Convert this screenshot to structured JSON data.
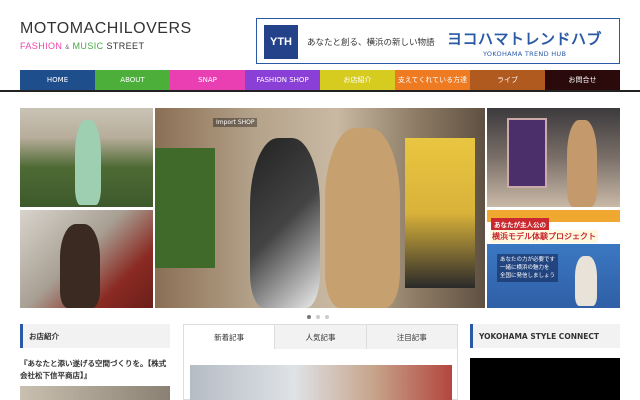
{
  "header": {
    "site_title": "MOTOMACHILOVERS",
    "sub_fashion": "FASHION",
    "sub_amp": "&",
    "sub_music": "MUSIC",
    "sub_street": "STREET"
  },
  "banner": {
    "logo_text": "YTH",
    "tagline": "あなたと創る、横浜の新しい物語",
    "brand": "ヨコハマトレンドハブ",
    "brand_en": "YOKOHAMA TREND HUB"
  },
  "nav": {
    "items": [
      {
        "label": "HOME",
        "color": "#1f4e8c"
      },
      {
        "label": "ABOUT",
        "color": "#4caf3a"
      },
      {
        "label": "SNAP",
        "color": "#e93fb2"
      },
      {
        "label": "FASHION SHOP",
        "color": "#8a3fd6"
      },
      {
        "label": "お店紹介",
        "color": "#d6cc1f"
      },
      {
        "label": "支えてくれている方達",
        "color": "#ee7a22"
      },
      {
        "label": "ライブ",
        "color": "#b05a1f"
      },
      {
        "label": "お問合せ",
        "color": "#2a0a0a"
      }
    ]
  },
  "slider": {
    "shop_sign": "Import   SHOP",
    "project_head": "あなたが主人公の",
    "project_title": "横浜モデル体験プロジェクト",
    "project_note_1": "あなたの力が必要です",
    "project_note_2": "一緒に横浜の魅力を",
    "project_note_3": "全国に発信しましょう"
  },
  "left_column": {
    "heading": "お店紹介",
    "shop_title": "『あなたと添い遂げる空間づくりを。【株式会社松下信平商店】』"
  },
  "tabs": {
    "items": [
      "新着記事",
      "人気記事",
      "注目記事"
    ],
    "active_index": 0
  },
  "right_column": {
    "heading": "YOKOHAMA STYLE CONNECT"
  }
}
